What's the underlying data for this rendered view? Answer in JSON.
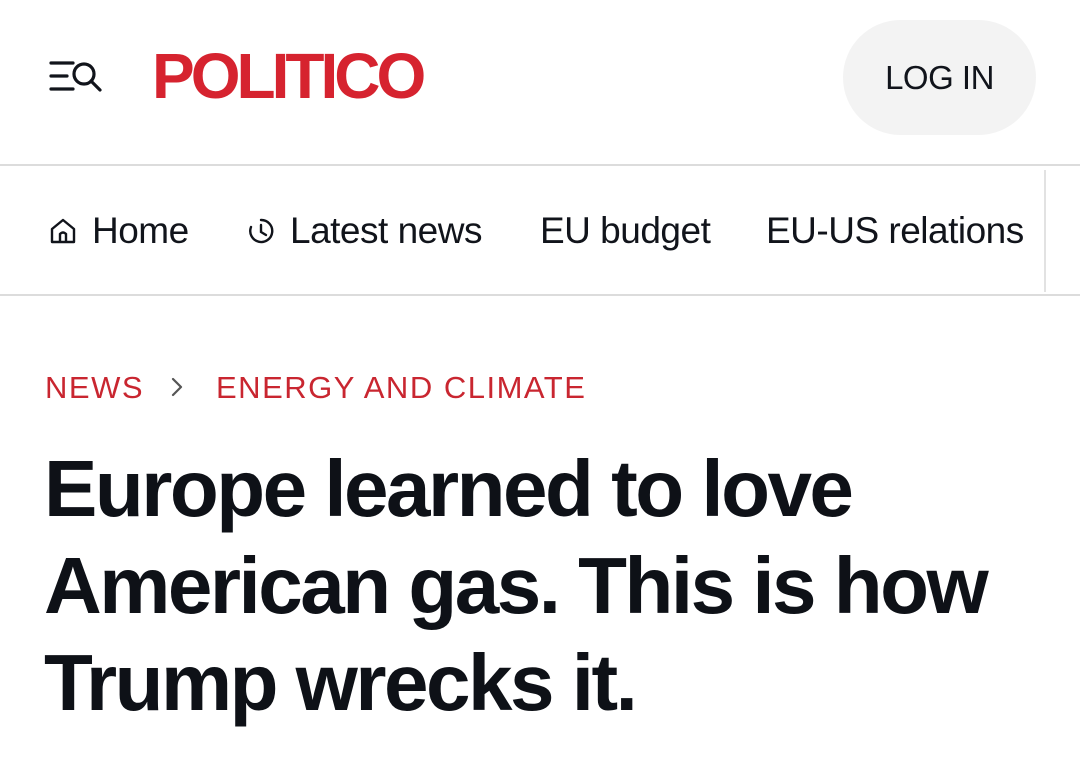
{
  "header": {
    "logo_text": "POLITICO",
    "login_label": "LOG IN"
  },
  "nav": {
    "items": [
      {
        "label": "Home",
        "icon": "home-icon"
      },
      {
        "label": "Latest news",
        "icon": "clock-icon"
      },
      {
        "label": "EU budget"
      },
      {
        "label": "EU-US relations"
      }
    ]
  },
  "breadcrumb": {
    "section": "NEWS",
    "subsection": "ENERGY AND CLIMATE",
    "separator": "›"
  },
  "article": {
    "headline": "Europe learned to love American gas. This is how Trump wrecks it."
  },
  "colors": {
    "brand": "#d6232f",
    "text": "#11141b",
    "divider": "#dcdcdc",
    "login_bg": "#f3f3f3"
  }
}
